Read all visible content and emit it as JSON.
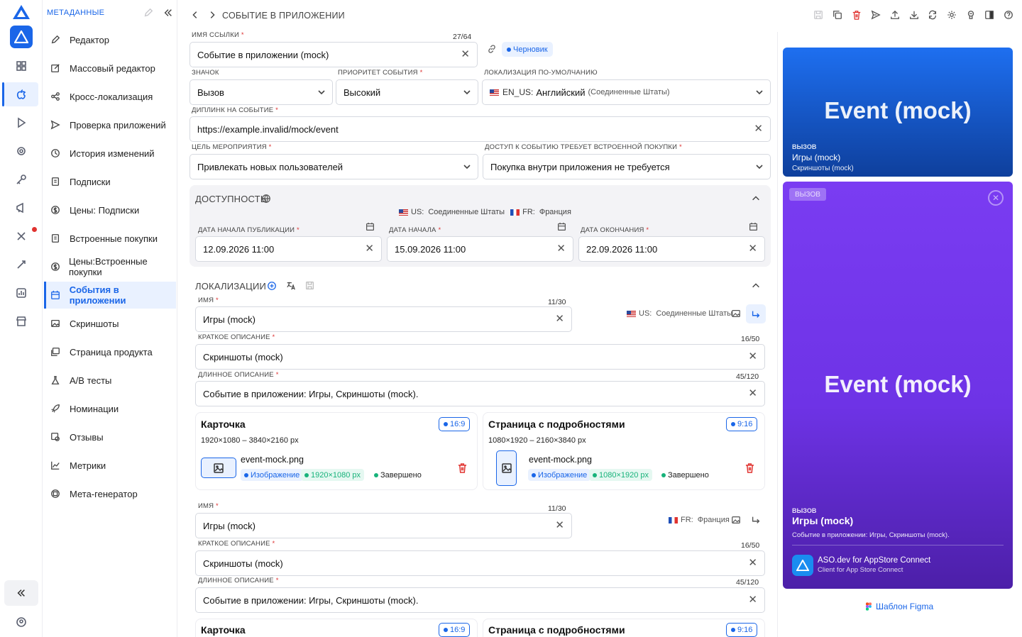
{
  "sidebar": {
    "header": "МЕТАДАННЫЕ",
    "items": [
      {
        "label": "Редактор",
        "icon": "pencil-icon"
      },
      {
        "label": "Массовый редактор",
        "icon": "edit-square-icon"
      },
      {
        "label": "Кросс-локализация",
        "icon": "share-icon"
      },
      {
        "label": "Проверка приложений",
        "icon": "send-icon"
      },
      {
        "label": "История изменений",
        "icon": "history-icon"
      },
      {
        "label": "Подписки",
        "icon": "doc-icon"
      },
      {
        "label": "Цены: Подписки",
        "icon": "dollar-icon"
      },
      {
        "label": "Встроенные покупки",
        "icon": "doc-icon"
      },
      {
        "label": "Цены:Встроенные покупки",
        "icon": "dollar-icon"
      },
      {
        "label": "События в приложении",
        "icon": "calendar-icon",
        "active": true
      },
      {
        "label": "Скриншоты",
        "icon": "image-icon"
      },
      {
        "label": "Страница продукта",
        "icon": "images-icon"
      },
      {
        "label": "A/B тесты",
        "icon": "flask-icon"
      },
      {
        "label": "Номинации",
        "icon": "rocket-icon"
      },
      {
        "label": "Отзывы",
        "icon": "review-icon"
      },
      {
        "label": "Метрики",
        "icon": "chart-icon"
      },
      {
        "label": "Мета-генератор",
        "icon": "cube-icon"
      }
    ]
  },
  "header": {
    "breadcrumb": "СОБЫТИЕ В ПРИЛОЖЕНИИ"
  },
  "form": {
    "link_name_label": "ИМЯ ССЫЛКИ",
    "link_name_count": "27/64",
    "link_name_value": "Событие в приложении (mock)",
    "status_badge": "Черновик",
    "badge_label": "ЗНАЧОК",
    "badge_value": "Вызов",
    "priority_label": "ПРИОРИТЕТ СОБЫТИЯ",
    "priority_value": "Высокий",
    "locale_label": "ЛОКАЛИЗАЦИЯ ПО-УМОЛЧАНИЮ",
    "locale_code": "EN_US:",
    "locale_name": "Английский",
    "locale_region": "(Соединенные Штаты)",
    "deeplink_label": "ДИПЛИНК НА СОБЫТИЕ",
    "deeplink_value": "https://example.invalid/mock/event",
    "goal_label": "ЦЕЛЬ МЕРОПРИЯТИЯ",
    "goal_value": "Привлекать новых пользователей",
    "purchase_label": "ДОСТУП К СОБЫТИЮ ТРЕБУЕТ ВСТРОЕННОЙ ПОКУПКИ",
    "purchase_value": "Покупка внутри приложения не требуется"
  },
  "availability": {
    "title": "ДОСТУПНОСТЬ",
    "country1_code": "US:",
    "country1_name": "Соединенные Штаты",
    "country2_code": "FR:",
    "country2_name": "Франция",
    "pub_label": "ДАТА НАЧАЛА ПУБЛИКАЦИИ",
    "pub_value": "12.09.2026 11:00",
    "start_label": "ДАТА НАЧАЛА",
    "start_value": "15.09.2026 11:00",
    "end_label": "ДАТА ОКОНЧАНИЯ",
    "end_value": "22.09.2026 11:00"
  },
  "localizations": {
    "title": "ЛОКАЛИЗАЦИИ",
    "items": [
      {
        "country_code": "US:",
        "country_name": "Соединенные Штаты",
        "name_label": "ИМЯ",
        "name_count": "11/30",
        "name_value": "Игры (mock)",
        "short_label": "КРАТКОЕ ОПИСАНИЕ",
        "short_count": "16/50",
        "short_value": "Скриншоты (mock)",
        "long_label": "ДЛИННОЕ ОПИСАНИЕ",
        "long_count": "45/120",
        "long_value": "Событие в приложении: Игры, Скриншоты (mock).",
        "card_title": "Карточка",
        "card_ratio": "16:9",
        "card_sizes": "1920×1080 – 3840×2160 px",
        "card_file": "event-mock.png",
        "card_tag_type": "Изображение",
        "card_tag_size": "1920×1080 px",
        "card_tag_status": "Завершено",
        "detail_title": "Страница с подробностями",
        "detail_ratio": "9:16",
        "detail_sizes": "1080×1920 – 2160×3840 px",
        "detail_file": "event-mock.png",
        "detail_tag_type": "Изображение",
        "detail_tag_size": "1080×1920 px",
        "detail_tag_status": "Завершено"
      },
      {
        "country_code": "FR:",
        "country_name": "Франция",
        "name_label": "ИМЯ",
        "name_count": "11/30",
        "name_value": "Игры (mock)",
        "short_label": "КРАТКОЕ ОПИСАНИЕ",
        "short_count": "16/50",
        "short_value": "Скриншоты (mock)",
        "long_label": "ДЛИННОЕ ОПИСАНИЕ",
        "long_count": "45/120",
        "long_value": "Событие в приложении: Игры, Скриншоты (mock).",
        "card_title": "Карточка",
        "card_ratio": "16:9",
        "detail_title": "Страница с подробностями",
        "detail_ratio": "9:16"
      }
    ]
  },
  "preview": {
    "card_title": "Event (mock)",
    "card_badge": "ВЫЗОВ",
    "card_name": "Игры (mock)",
    "card_short": "Скриншоты (mock)",
    "detail_chip": "ВЫЗОВ",
    "detail_title": "Event (mock)",
    "detail_badge": "ВЫЗОВ",
    "detail_name": "Игры (mock)",
    "detail_long": "Событие в приложении: Игры, Скриншоты (mock).",
    "app_name": "ASO.dev for AppStore Connect",
    "app_sub": "Client for App Store Connect",
    "figma_link": "Шаблон Figma"
  },
  "colors": {
    "accent": "#1a66e8",
    "danger": "#e0322f",
    "success": "#17b27a",
    "preview_blue": "#1e6ff0",
    "preview_purple": "#7a3cf2"
  }
}
